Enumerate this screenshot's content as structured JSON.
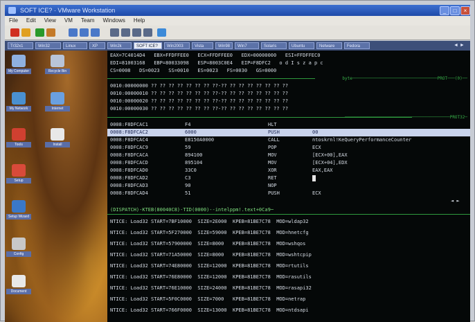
{
  "window": {
    "title": "SOFT ICE? · VMware Workstation",
    "controls": [
      "_",
      "□",
      "×"
    ]
  },
  "menubar": {
    "items": [
      "File",
      "Edit",
      "View",
      "VM",
      "Team",
      "Windows",
      "Help"
    ]
  },
  "toolbar": {
    "buttons": [
      {
        "icon": "stop-icon",
        "color": "#d03020"
      },
      {
        "icon": "pause-icon",
        "color": "#e0a020"
      },
      {
        "icon": "play-icon",
        "color": "#2a9a2a"
      },
      {
        "icon": "home-icon",
        "color": "#c47a28"
      },
      {
        "icon": "revert-icon",
        "color": "#4a78c8"
      },
      {
        "icon": "snapshot-icon",
        "color": "#4a78c8"
      },
      {
        "icon": "snapshot-manager-icon",
        "color": "#4a78c8"
      },
      {
        "icon": "full-screen-icon",
        "color": "#5a6a88"
      },
      {
        "icon": "quick-switch-icon",
        "color": "#5a6a88"
      },
      {
        "icon": "console-icon",
        "color": "#5a6a88"
      },
      {
        "icon": "summary-icon",
        "color": "#5a6a88"
      },
      {
        "icon": "appliance-icon",
        "color": "#3c8ad8"
      }
    ]
  },
  "tabs": {
    "items": [
      "Tr32x1",
      "Win32",
      "Linux",
      "XP",
      "Win2k",
      "SOFT ICE?",
      "Win2003",
      "Vista",
      "Win98",
      "Win7",
      "Solaris",
      "Ubuntu",
      "Netware",
      "Fedora"
    ],
    "active_index": 5,
    "scroll_label": "◄ ►"
  },
  "desktop": {
    "icons": [
      {
        "label": "My Computer",
        "icon": "computer-icon",
        "color": "#8fb0e0"
      },
      {
        "label": "Recycle Bin",
        "icon": "recycle-bin-icon",
        "color": "#b8c4d8"
      },
      {
        "label": "My Network",
        "icon": "network-icon",
        "color": "#4a90d0"
      },
      {
        "label": "Internet",
        "icon": "internet-icon",
        "color": "#6aa0e0"
      },
      {
        "label": "Tools",
        "icon": "tools-icon",
        "color": "#d04030"
      },
      {
        "label": "Install",
        "icon": "install-icon",
        "color": "#e8e8e8"
      },
      {
        "label": "Setup",
        "icon": "setup-icon",
        "color": "#d84a3a"
      },
      {
        "label": "Setup Wizard",
        "icon": "wizard-icon",
        "color": "#3a78c8"
      },
      {
        "label": "Config",
        "icon": "config-icon",
        "color": "#c8c8c8"
      },
      {
        "label": "Document",
        "icon": "document-icon",
        "color": "#e8e8e8"
      }
    ]
  },
  "registers": {
    "line1": "EAX=7C4014D4   EBX=FFDFFEE0   ECX=FFDFFEE0   EDX=00000000   ESI=FFDFFEC0",
    "line2": "EDI=81003168   EBP=80033098   ESP=8003C0E4   EIP=F8DFC2   o d I s z a p c",
    "line3": "CS=0008   DS=0023   SS=0010   ES=0023   FS=0030   GS=0000"
  },
  "data_pane": {
    "header": "byte──────────────────────────────────PROT───(0)──",
    "rows": [
      "0010:00000000 ?? ?? ?? ?? ?? ?? ?? ??-?? ?? ?? ?? ?? ?? ?? ??",
      "0010:00000010 ?? ?? ?? ?? ?? ?? ?? ??-?? ?? ?? ?? ?? ?? ?? ??",
      "0010:00000020 ?? ?? ?? ?? ?? ?? ?? ??-?? ?? ?? ?? ?? ?? ?? ??",
      "0010:00000030 ?? ?? ?? ?? ?? ?? ?? ??-?? ?? ?? ?? ?? ?? ?? ??"
    ]
  },
  "code_pane": {
    "header": "──────────────────────────────────────────PROT32─",
    "highlight_index": 1,
    "rows": [
      {
        "addr": "0008:F8DFCAC1",
        "bytes": "F4",
        "mnem": "HLT",
        "ops": ""
      },
      {
        "addr": "0008:F8DFCAC2",
        "bytes": "6000",
        "mnem": "PUSH",
        "ops": "00"
      },
      {
        "addr": "0008:F8DFCAC4",
        "bytes": "E8150A0000",
        "mnem": "CALL",
        "ops": "ntoskrnl!KeQueryPerformanceCounter"
      },
      {
        "addr": "0008:F8DFCAC9",
        "bytes": "59",
        "mnem": "POP",
        "ops": "ECX"
      },
      {
        "addr": "0008:F8DFCACA",
        "bytes": "894100",
        "mnem": "MOV",
        "ops": "[ECX+00],EAX"
      },
      {
        "addr": "0008:F8DFCACD",
        "bytes": "895104",
        "mnem": "MOV",
        "ops": "[ECX+04],EDX"
      },
      {
        "addr": "0008:F8DFCAD0",
        "bytes": "33C0",
        "mnem": "XOR",
        "ops": "EAX,EAX"
      },
      {
        "addr": "0008:F8DFCAD2",
        "bytes": "C3",
        "mnem": "RET",
        "ops": ""
      },
      {
        "addr": "0008:F8DFCAD3",
        "bytes": "90",
        "mnem": "NOP",
        "ops": ""
      },
      {
        "addr": "0008:F8DFCAD4",
        "bytes": "51",
        "mnem": "PUSH",
        "ops": "ECX"
      }
    ],
    "arrows": "◄ ►"
  },
  "status_line": "(DISPATCH)-KTEB(80040C8)-TID(0000)--intelppm!.text+0Ca9─",
  "log": {
    "rows": [
      "NTICE: Load32 START=7BF10000  SIZE=2E000  KPEB=81BE7C78  MOD=wldap32",
      "NTICE: Load32 START=5F270000  SIZE=59000  KPEB=81BE7C78  MOD=hnetcfg",
      "NTICE: Load32 START=57900000  SIZE=8000   KPEB=81BE7C78  MOD=wshqos",
      "NTICE: Load32 START=71A50000  SIZE=8000   KPEB=81BE7C78  MOD=wshtcpip",
      "NTICE: Load32 START=74E80000  SIZE=12000  KPEB=81BE7C78  MOD=rtutils",
      "NTICE: Load32 START=76E80000  SIZE=12000  KPEB=81BE7C78  MOD=rasutils",
      "NTICE: Load32 START=76E10000  SIZE=24000  KPEB=81BE7C78  MOD=rasapi32",
      "NTICE: Load32 START=5F0C0000  SIZE=7000   KPEB=81BE7C78  MOD=netrap",
      "NTICE: Load32 START=766F0000  SIZE=13000  KPEB=81BE7C78  MOD=ntdsapi"
    ]
  }
}
